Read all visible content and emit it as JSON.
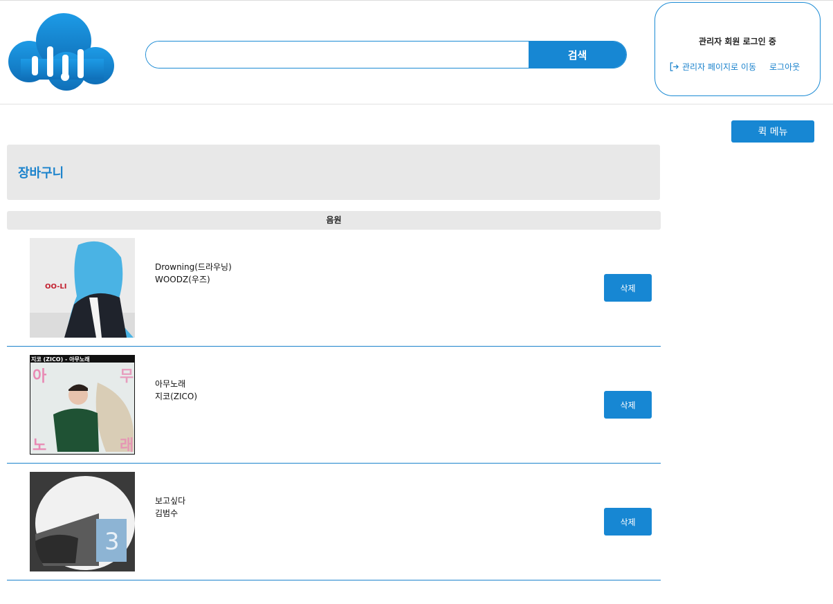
{
  "search": {
    "value": "",
    "placeholder": "",
    "button_label": "검색"
  },
  "account": {
    "status": "관리자 회원 로그인 중",
    "admin_link": "관리자 페이지로 이동",
    "logout_link": "로그아웃",
    "admin_link_icon": "sign-in-icon"
  },
  "quick_menu_label": "퀵 메뉴",
  "page_title": "장바구니",
  "column_header": "음원",
  "cart": [
    {
      "title": "Drowning(드라우닝)",
      "artist": "WOODZ(우즈)",
      "delete_label": "삭제",
      "cover_text": "OO-LI",
      "cover_colors": [
        "#e9e9e9",
        "#4fb7e6",
        "#20232b"
      ]
    },
    {
      "title": "아무노래",
      "artist": "지코(ZICO)",
      "delete_label": "삭제",
      "cover_text": "지코 (ZICO) - 아무노래",
      "cover_glyphs": [
        "아",
        "무",
        "노",
        "래"
      ],
      "cover_colors": [
        "#e7ebea",
        "#2a5a3a",
        "#e88ab4"
      ]
    },
    {
      "title": "보고싶다",
      "artist": "김범수",
      "delete_label": "삭제",
      "cover_text": "3",
      "cover_colors": [
        "#3b3b3b",
        "#f2f2f2",
        "#8fb6d6"
      ]
    }
  ],
  "colors": {
    "accent": "#1787d3",
    "panel": "#e8e8e8",
    "title": "#1a82cc"
  }
}
